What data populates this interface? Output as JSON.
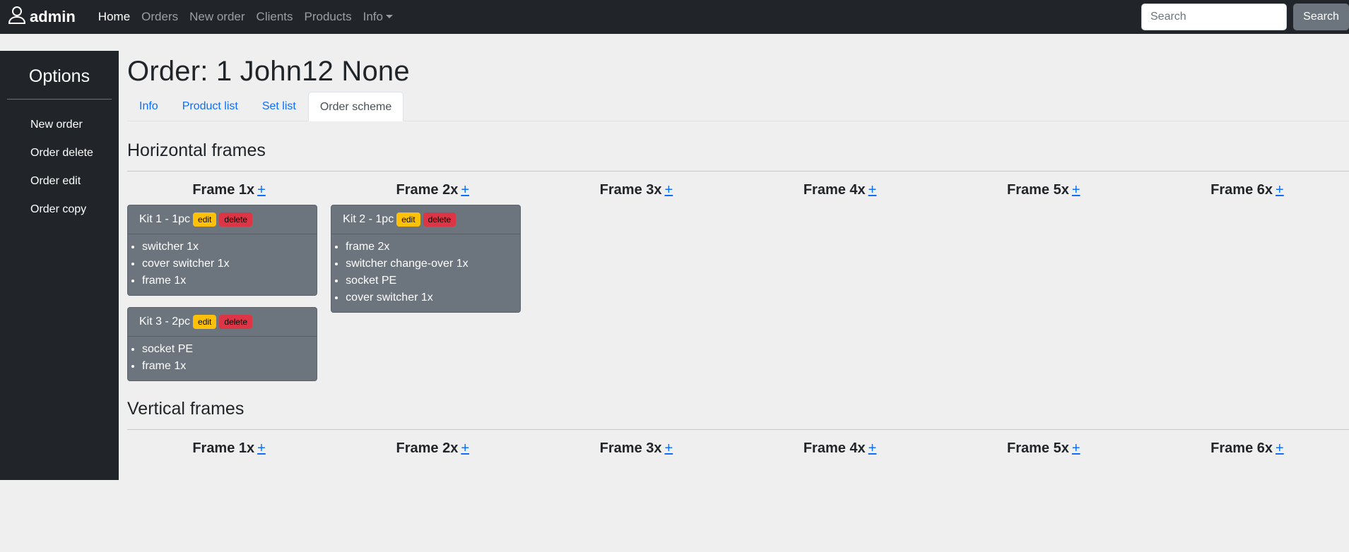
{
  "navbar": {
    "brand": "admin",
    "links": [
      "Home",
      "Orders",
      "New order",
      "Clients",
      "Products",
      "Info"
    ],
    "search_placeholder": "Search",
    "search_button": "Search"
  },
  "sidebar": {
    "title": "Options",
    "items": [
      "New order",
      "Order delete",
      "Order edit",
      "Order copy"
    ]
  },
  "page": {
    "title": "Order: 1 John12 None",
    "tabs": [
      "Info",
      "Product list",
      "Set list",
      "Order scheme"
    ],
    "active_tab": "Order scheme"
  },
  "horizontal": {
    "title": "Horizontal frames",
    "frames": [
      "Frame 1x",
      "Frame 2x",
      "Frame 3x",
      "Frame 4x",
      "Frame 5x",
      "Frame 6x"
    ],
    "plus": "+",
    "kits": {
      "f1k1": {
        "title": "Kit 1 - 1pc",
        "edit": "edit",
        "delete": "delete",
        "items": [
          "switcher 1x",
          "cover switcher 1x",
          "frame 1x"
        ]
      },
      "f1k3": {
        "title": "Kit 3 - 2pc",
        "edit": "edit",
        "delete": "delete",
        "items": [
          "socket PE",
          "frame 1x"
        ]
      },
      "f2k2": {
        "title": "Kit 2 - 1pc",
        "edit": "edit",
        "delete": "delete",
        "items": [
          "frame 2x",
          "switcher change-over 1x",
          "socket PE",
          "cover switcher 1x"
        ]
      }
    }
  },
  "vertical": {
    "title": "Vertical frames",
    "frames": [
      "Frame 1x",
      "Frame 2x",
      "Frame 3x",
      "Frame 4x",
      "Frame 5x",
      "Frame 6x"
    ],
    "plus": "+"
  },
  "colors": {
    "navbar_bg": "#212529",
    "link_blue": "#0d6efd",
    "kit_bg": "#6c757d",
    "edit_badge": "#ffc107",
    "delete_badge": "#dc3545"
  }
}
